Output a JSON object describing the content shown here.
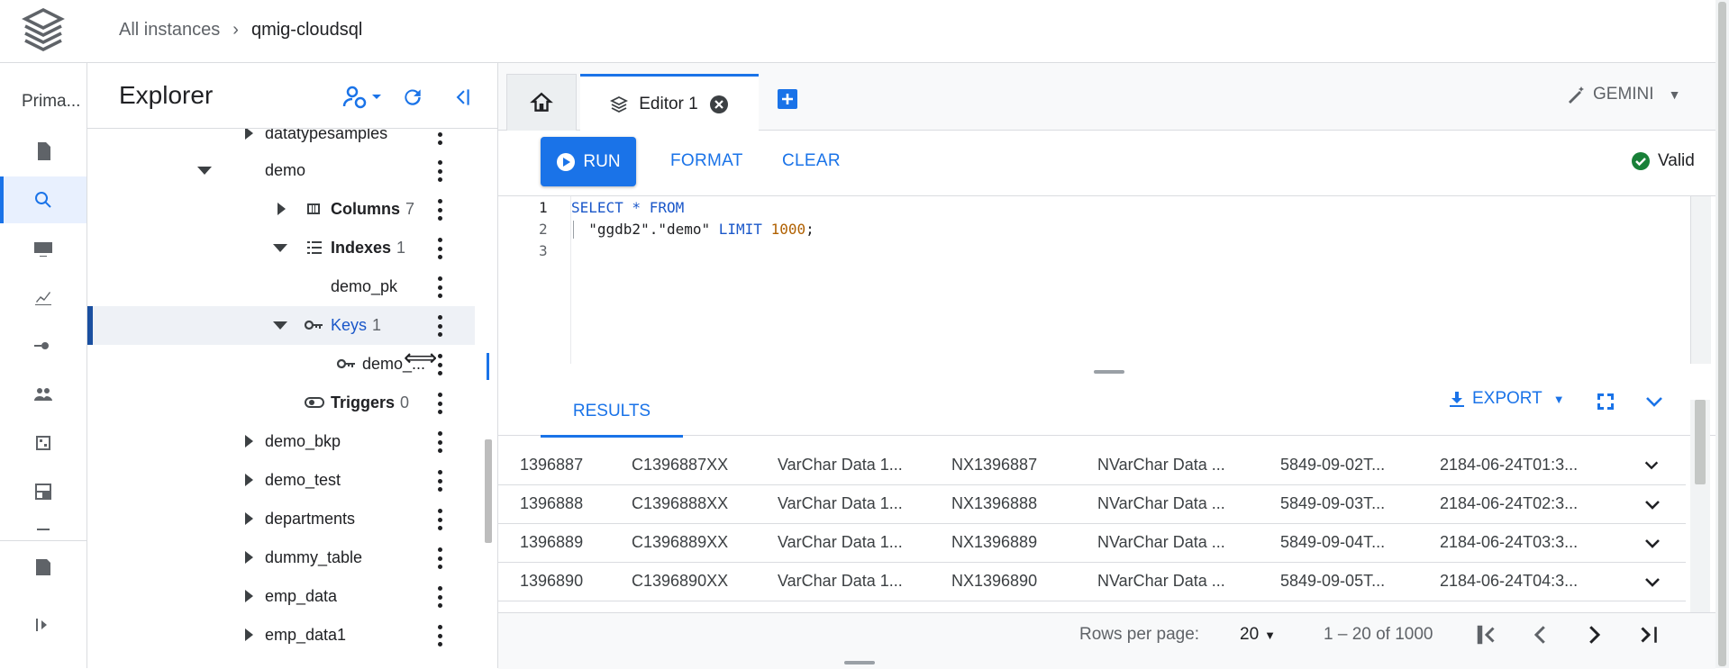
{
  "breadcrumb": {
    "root": "All instances",
    "current": "qmig-cloudsql"
  },
  "rail": {
    "title": "Prima...",
    "icons": [
      "document-icon",
      "search-icon",
      "monitor-icon",
      "chart-icon",
      "migration-icon",
      "users-icon",
      "calendar-icon",
      "dashboard-icon",
      "more-icon",
      "notes-icon",
      "expand-icon"
    ]
  },
  "explorer": {
    "title": "Explorer",
    "rows": [
      {
        "label": "datatypesamples",
        "count": ""
      },
      {
        "label": "demo",
        "count": ""
      },
      {
        "label": "Columns",
        "count": "7"
      },
      {
        "label": "Indexes",
        "count": "1"
      },
      {
        "label": "demo_pk",
        "count": ""
      },
      {
        "label": "Keys",
        "count": "1"
      },
      {
        "label": "demo_...",
        "count": ""
      },
      {
        "label": "Triggers",
        "count": "0"
      },
      {
        "label": "demo_bkp",
        "count": ""
      },
      {
        "label": "demo_test",
        "count": ""
      },
      {
        "label": "departments",
        "count": ""
      },
      {
        "label": "dummy_table",
        "count": ""
      },
      {
        "label": "emp_data",
        "count": ""
      },
      {
        "label": "emp_data1",
        "count": ""
      }
    ]
  },
  "tabs": {
    "editor": "Editor 1",
    "gemini": "GEMINI"
  },
  "toolbar": {
    "run": "RUN",
    "format": "FORMAT",
    "clear": "CLEAR",
    "status": "Valid"
  },
  "code": {
    "lines": [
      "1",
      "2",
      "3"
    ],
    "l1_kw": "SELECT * FROM",
    "l2_a": "  \"ggdb2\".\"demo\" ",
    "l2_kw": "LIMIT",
    "l2_num": " 1000",
    "l2_end": ";"
  },
  "results": {
    "tab": "RESULTS",
    "export": "EXPORT",
    "rows": [
      [
        "1396887",
        "C1396887XX",
        "VarChar Data 1...",
        "NX1396887",
        "NVarChar Data ...",
        "5849-09-02T...",
        "2184-06-24T01:3..."
      ],
      [
        "1396888",
        "C1396888XX",
        "VarChar Data 1...",
        "NX1396888",
        "NVarChar Data ...",
        "5849-09-03T...",
        "2184-06-24T02:3..."
      ],
      [
        "1396889",
        "C1396889XX",
        "VarChar Data 1...",
        "NX1396889",
        "NVarChar Data ...",
        "5849-09-04T...",
        "2184-06-24T03:3..."
      ],
      [
        "1396890",
        "C1396890XX",
        "VarChar Data 1...",
        "NX1396890",
        "NVarChar Data ...",
        "5849-09-05T...",
        "2184-06-24T04:3..."
      ]
    ]
  },
  "footer": {
    "rows_label": "Rows per page:",
    "rows_value": "20",
    "range": "1 – 20 of 1000"
  },
  "colors": {
    "accent": "#1a73e8",
    "valid": "#188038"
  }
}
